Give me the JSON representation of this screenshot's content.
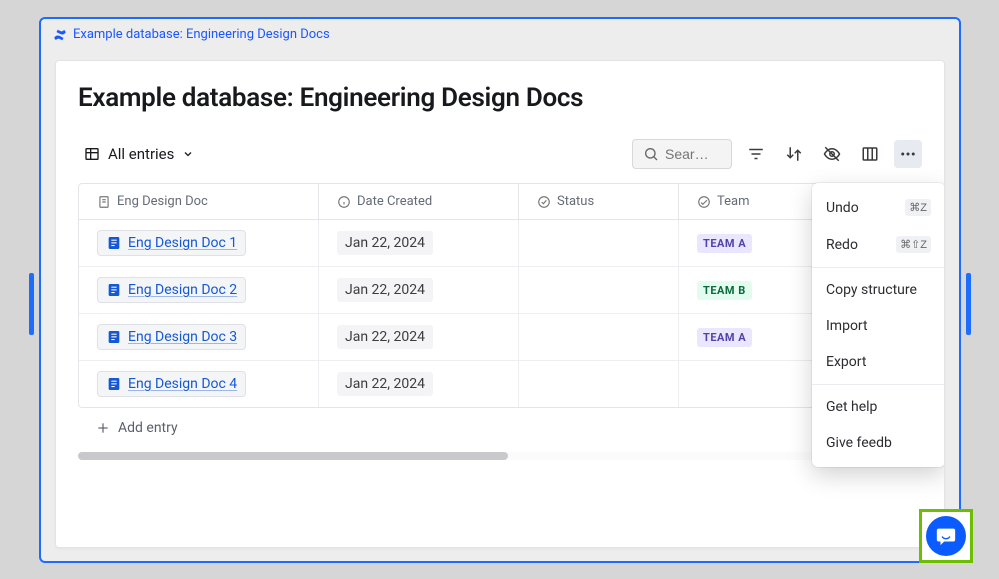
{
  "frame_title": "Example database: Engineering Design Docs",
  "page_title": "Example database: Engineering Design Docs",
  "view_selector_label": "All entries",
  "search_placeholder": "Sear…",
  "columns": {
    "doc": "Eng Design Doc",
    "date": "Date Created",
    "status": "Status",
    "team": "Team"
  },
  "rows": [
    {
      "doc": "Eng Design Doc 1",
      "date": "Jan 22, 2024",
      "status": "",
      "team": "TEAM A",
      "team_class": "team-a"
    },
    {
      "doc": "Eng Design Doc 2",
      "date": "Jan 22, 2024",
      "status": "",
      "team": "TEAM B",
      "team_class": "team-b"
    },
    {
      "doc": "Eng Design Doc 3",
      "date": "Jan 22, 2024",
      "status": "",
      "team": "TEAM A",
      "team_class": "team-a"
    },
    {
      "doc": "Eng Design Doc 4",
      "date": "Jan 22, 2024",
      "status": "",
      "team": "",
      "team_class": ""
    }
  ],
  "add_entry_label": "Add entry",
  "menu": {
    "undo": "Undo",
    "undo_shortcut": "⌘Z",
    "redo": "Redo",
    "redo_shortcut": "⌘⇧Z",
    "copy_structure": "Copy structure",
    "import": "Import",
    "export": "Export",
    "get_help": "Get help",
    "give_feedback": "Give feedb"
  }
}
